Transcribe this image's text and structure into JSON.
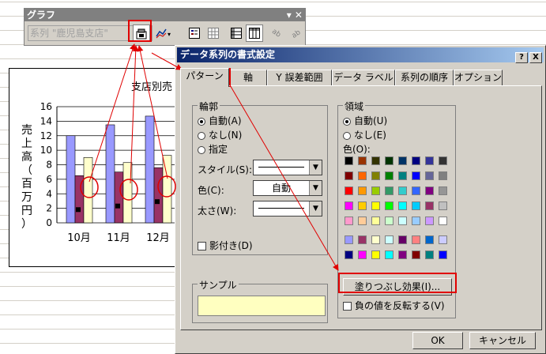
{
  "toolbar": {
    "title": "グラフ",
    "title_controls": "▾ ✕",
    "series_select": "系列 \"鹿児島支店\"",
    "buttons": [
      "format-series",
      "chart-type",
      "legend",
      "data-table",
      "by-row",
      "by-column",
      "angle-down",
      "angle-up"
    ]
  },
  "chart": {
    "title": "支店別売",
    "y_axis_label": [
      "売",
      "上",
      "高",
      "（",
      "百",
      "万",
      "円",
      "）"
    ],
    "chart_data": {
      "type": "bar",
      "categories": [
        "10月",
        "11月",
        "12月"
      ],
      "yticks": [
        "16",
        "14",
        "12",
        "10",
        "8",
        "6",
        "4",
        "2",
        "0"
      ],
      "ylim": [
        0,
        16
      ],
      "series": [
        {
          "values": [
            12,
            13.5,
            14.7
          ],
          "color": "#9999ff"
        },
        {
          "values": [
            6.5,
            7,
            7.6
          ],
          "color": "#993366"
        },
        {
          "values": [
            9,
            8.3,
            9.3
          ],
          "color": "#ffffcc"
        }
      ]
    }
  },
  "dialog": {
    "title": "データ系列の書式設定",
    "title_buttons": [
      "?",
      "X"
    ],
    "tabs": [
      "パターン",
      "軸",
      "Y 誤差範囲",
      "データ ラベル",
      "系列の順序",
      "オプション"
    ],
    "border": {
      "label": "輪郭",
      "options": [
        "自動(A)",
        "なし(N)",
        "指定"
      ],
      "style_label": "スタイル(S):",
      "color_label": "色(C):",
      "color_value": "自動",
      "weight_label": "太さ(W):",
      "shadow_label": "影付き(D)"
    },
    "area": {
      "label": "領域",
      "options": [
        "自動(U)",
        "なし(E)"
      ],
      "color_label": "色(O):",
      "fill_effects_button": "塗りつぶし効果(I)...",
      "invert_label": "負の値を反転する(V)"
    },
    "sample_label": "サンプル",
    "ok_button": "OK",
    "cancel_button": "キャンセル",
    "colors": {
      "palette": [
        [
          "#000000",
          "#993300",
          "#333300",
          "#003300",
          "#003366",
          "#000080",
          "#333399",
          "#333333"
        ],
        [
          "#800000",
          "#ff6600",
          "#808000",
          "#008000",
          "#008080",
          "#0000ff",
          "#666699",
          "#808080"
        ],
        [
          "#ff0000",
          "#ff9900",
          "#99cc00",
          "#339966",
          "#33cccc",
          "#3366ff",
          "#800080",
          "#969696"
        ],
        [
          "#ff00ff",
          "#ffcc00",
          "#ffff00",
          "#00ff00",
          "#00ffff",
          "#00ccff",
          "#993366",
          "#c0c0c0"
        ],
        [
          "#ff99cc",
          "#ffcc99",
          "#ffff99",
          "#ccffcc",
          "#ccffff",
          "#99ccff",
          "#cc99ff",
          "#ffffff"
        ]
      ],
      "chart_palette": [
        [
          "#9999ff",
          "#993366",
          "#ffffcc",
          "#ccffff",
          "#660066",
          "#ff8080",
          "#0066cc",
          "#ccccff"
        ],
        [
          "#000080",
          "#ff00ff",
          "#ffff00",
          "#00ffff",
          "#800080",
          "#800000",
          "#008080",
          "#0000ff"
        ]
      ]
    }
  }
}
